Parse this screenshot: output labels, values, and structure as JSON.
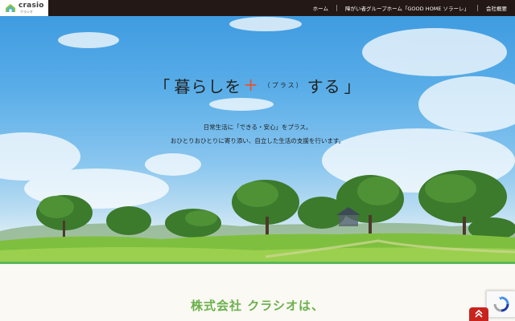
{
  "header": {
    "logo_name": "crasio",
    "logo_sub": "クラシオ",
    "nav": [
      "ホーム",
      "障がい者グループホーム「GOOD HOME ソラーレ」",
      "会社概要"
    ]
  },
  "hero": {
    "title_open": "「",
    "title_main": "暮らしを",
    "title_plus": "+",
    "title_small": "（プラス）",
    "title_end": "する",
    "title_close": "」",
    "lines": [
      "日常生活に「できる・安心」をプラス。",
      "おひとりおひとりに寄り添い、自立した生活の支援を行います。"
    ]
  },
  "section": {
    "heading": "株式会社 クラシオは、"
  },
  "colors": {
    "topbar": "#231815",
    "accent_green": "#6ab04c",
    "plus_orange": "#e8522f",
    "scroll_red": "#c8231c"
  },
  "icons": [
    "logo-house-icon",
    "double-chevron-up-icon",
    "recaptcha-icon"
  ]
}
